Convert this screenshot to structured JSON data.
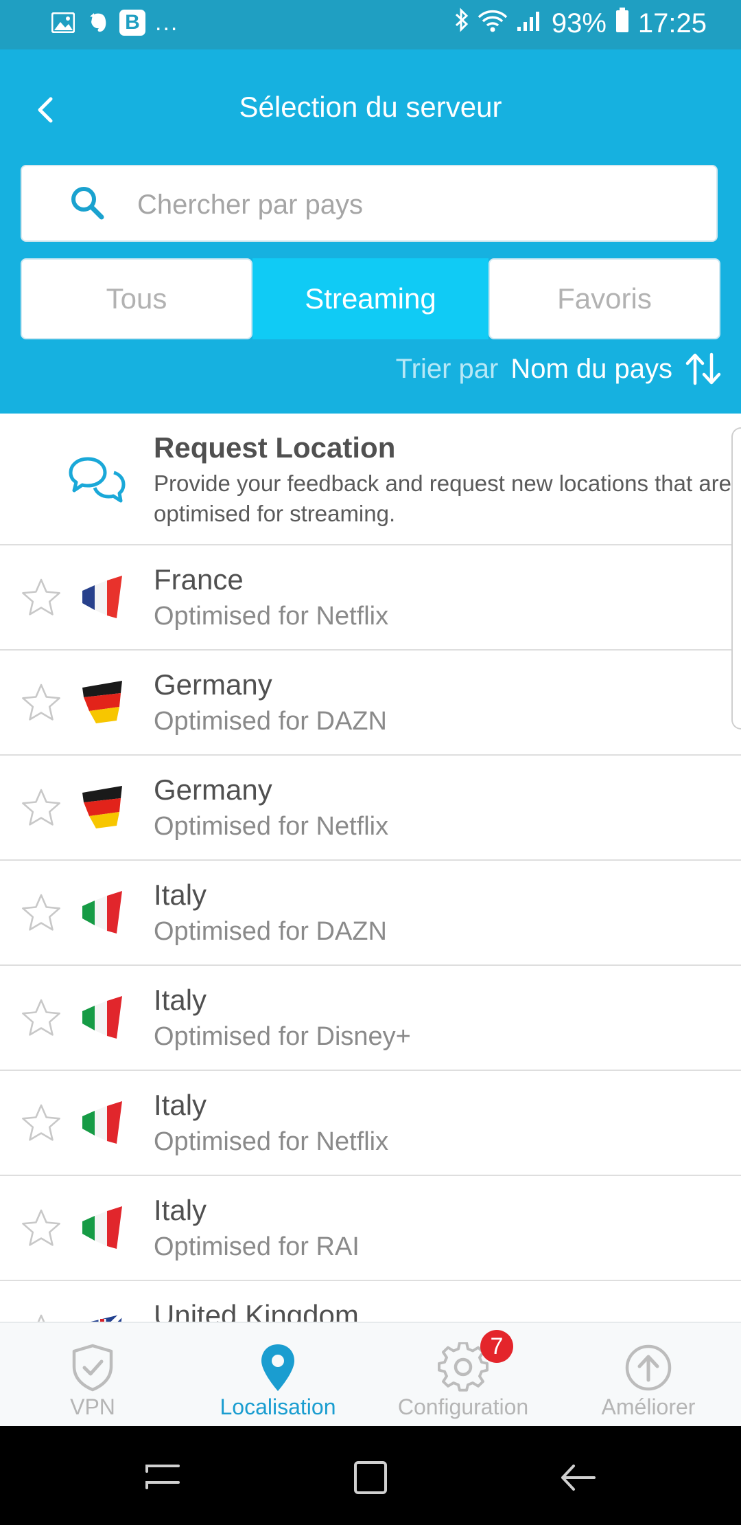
{
  "status_bar": {
    "battery": "93%",
    "time": "17:25",
    "app_b": "B",
    "more": "..."
  },
  "header": {
    "title": "Sélection du serveur",
    "search_placeholder": "Chercher par pays",
    "tabs": [
      {
        "label": "Tous",
        "active": false
      },
      {
        "label": "Streaming",
        "active": true
      },
      {
        "label": "Favoris",
        "active": false
      }
    ],
    "sort_label": "Trier par",
    "sort_value": "Nom du pays"
  },
  "request": {
    "title": "Request Location",
    "description": "Provide your feedback and request new locations that are optimised for streaming."
  },
  "servers": [
    {
      "name": "France",
      "subtitle": "Optimised for Netflix",
      "flag": "fr"
    },
    {
      "name": "Germany",
      "subtitle": "Optimised for DAZN",
      "flag": "de"
    },
    {
      "name": "Germany",
      "subtitle": "Optimised for Netflix",
      "flag": "de"
    },
    {
      "name": "Italy",
      "subtitle": "Optimised for DAZN",
      "flag": "it"
    },
    {
      "name": "Italy",
      "subtitle": "Optimised for Disney+",
      "flag": "it"
    },
    {
      "name": "Italy",
      "subtitle": "Optimised for Netflix",
      "flag": "it"
    },
    {
      "name": "Italy",
      "subtitle": "Optimised for RAI",
      "flag": "it"
    },
    {
      "name": "United Kingdom",
      "subtitle": "",
      "flag": "gb"
    }
  ],
  "bottom_nav": [
    {
      "label": "VPN",
      "icon": "shield-check-icon",
      "active": false
    },
    {
      "label": "Localisation",
      "icon": "location-pin-icon",
      "active": true
    },
    {
      "label": "Configuration",
      "icon": "gear-icon",
      "active": false,
      "badge": "7"
    },
    {
      "label": "Améliorer",
      "icon": "upgrade-arrow-icon",
      "active": false
    }
  ],
  "colors": {
    "header_bg": "#16b1e0",
    "active_tab": "#10cbf5",
    "accent": "#1a9dd0",
    "badge": "#e4252b"
  }
}
